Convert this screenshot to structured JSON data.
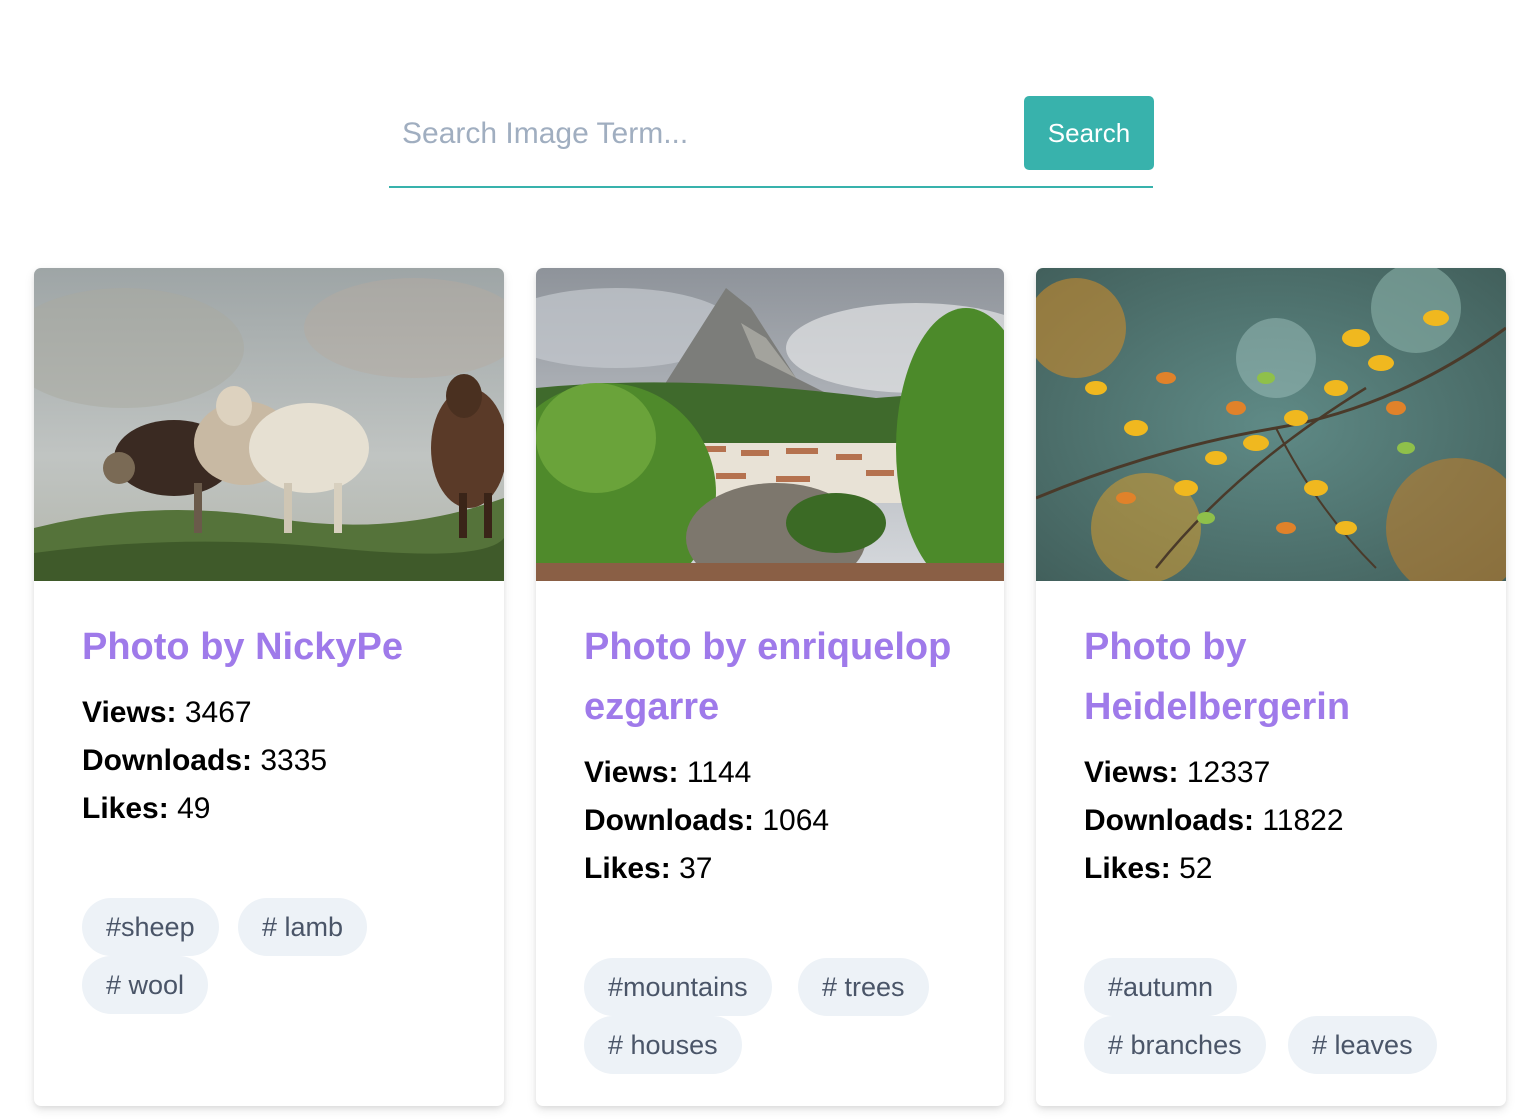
{
  "search": {
    "placeholder": "Search Image Term...",
    "button_label": "Search",
    "accent_color": "#38b2ac"
  },
  "cards": [
    {
      "title": "Photo by NickyPe",
      "image_alt": "sheep on a foggy hillside",
      "stats": [
        {
          "label": "Views:",
          "value": "3467"
        },
        {
          "label": "Downloads:",
          "value": "3335"
        },
        {
          "label": "Likes:",
          "value": "49"
        }
      ],
      "tags": [
        "#sheep",
        "# lamb",
        "# wool"
      ]
    },
    {
      "title": "Photo by enriquelopezgarre",
      "image_alt": "mountain peak above a white village and trees",
      "stats": [
        {
          "label": "Views:",
          "value": "1144"
        },
        {
          "label": "Downloads:",
          "value": "1064"
        },
        {
          "label": "Likes:",
          "value": "37"
        }
      ],
      "tags": [
        "#mountains",
        "# trees",
        "# houses"
      ]
    },
    {
      "title": "Photo by Heidelbergerin",
      "image_alt": "yellow autumn leaves on branches",
      "stats": [
        {
          "label": "Views:",
          "value": "12337"
        },
        {
          "label": "Downloads:",
          "value": "11822"
        },
        {
          "label": "Likes:",
          "value": "52"
        }
      ],
      "tags": [
        "#autumn",
        "# branches",
        "# leaves"
      ]
    }
  ],
  "colors": {
    "title": "#9f7aea",
    "tag_background": "#edf2f7",
    "tag_text": "#4a5568"
  }
}
